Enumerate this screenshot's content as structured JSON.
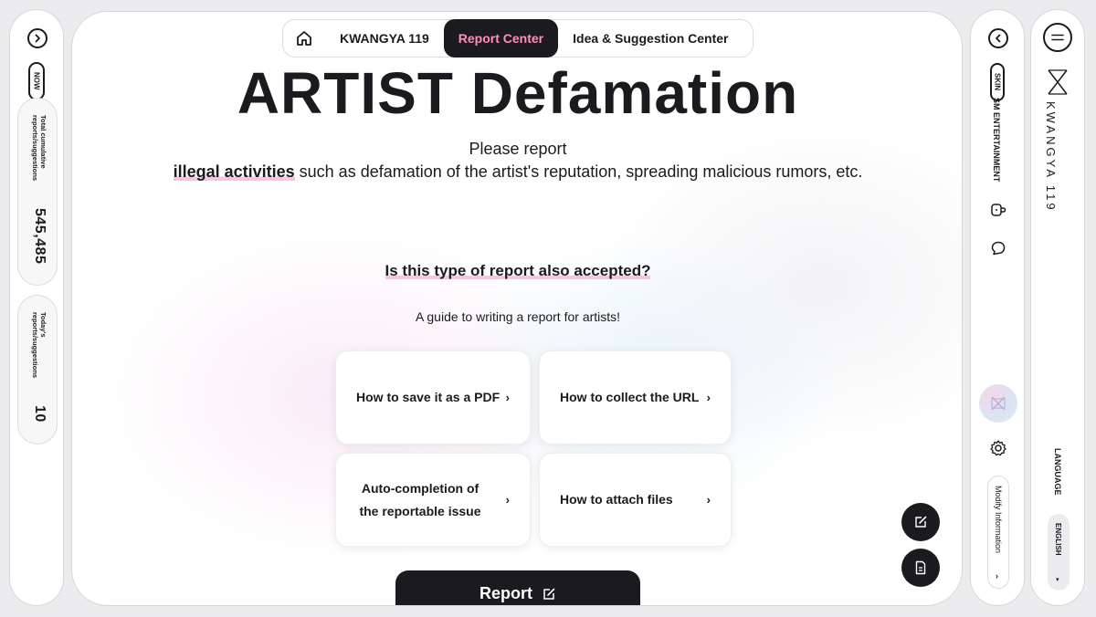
{
  "left_sidebar": {
    "now_label": "NOW",
    "total_label": "Total cumulative reports/suggestions",
    "total_value": "545,485",
    "today_label": "Today's reports/suggestions",
    "today_value": "10"
  },
  "nav": {
    "tabs": [
      {
        "label": "KWANGYA 119",
        "active": false
      },
      {
        "label": "Report Center",
        "active": true
      },
      {
        "label": "Idea & Suggestion Center",
        "active": false
      }
    ]
  },
  "main": {
    "title": "ARTIST Defamation",
    "subtitle_line1": "Please report",
    "subtitle_bold": "illegal activities",
    "subtitle_rest": " such as defamation of the artist's reputation, spreading malicious rumors, etc.",
    "question": "Is this type of report also accepted?",
    "guide": "A guide to writing a report for artists!",
    "cards": [
      {
        "label": "How to save it as a PDF"
      },
      {
        "label": "How to collect the URL"
      },
      {
        "label": "Auto-completion of the reportable issue"
      },
      {
        "label": "How to attach files"
      }
    ],
    "report_button": "Report"
  },
  "right_sidebar": {
    "skin_label": "SKIN",
    "company_label": "SM ENTERTAINMENT",
    "modify_label": "Modify Information",
    "avatar_text": "KWANGYA 119"
  },
  "brand_sidebar": {
    "brand": "KWANGYA 119",
    "language_label": "LANGUAGE",
    "language_value": "ENGLISH"
  },
  "colors": {
    "accent_pink": "#ff8fb8",
    "dark": "#1b1b1f",
    "highlight": "#f3c7e0"
  }
}
